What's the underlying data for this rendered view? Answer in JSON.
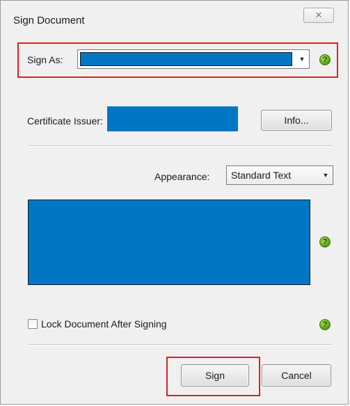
{
  "window": {
    "title": "Sign Document",
    "close_glyph": "✕"
  },
  "sign_as": {
    "label": "Sign As:",
    "value": "",
    "arrow": "▼"
  },
  "certificate": {
    "issuer_label": "Certificate Issuer:",
    "issuer_value": "",
    "info_button": "Info..."
  },
  "appearance": {
    "label": "Appearance:",
    "value": "Standard Text",
    "arrow": "▼"
  },
  "lock": {
    "label": "Lock Document After Signing",
    "checked": false
  },
  "buttons": {
    "sign": "Sign",
    "cancel": "Cancel"
  },
  "help": {
    "glyph": "?"
  },
  "colors": {
    "redacted": "#0077c4",
    "highlight": "#e02020",
    "help_icon": "#4f9a12"
  }
}
